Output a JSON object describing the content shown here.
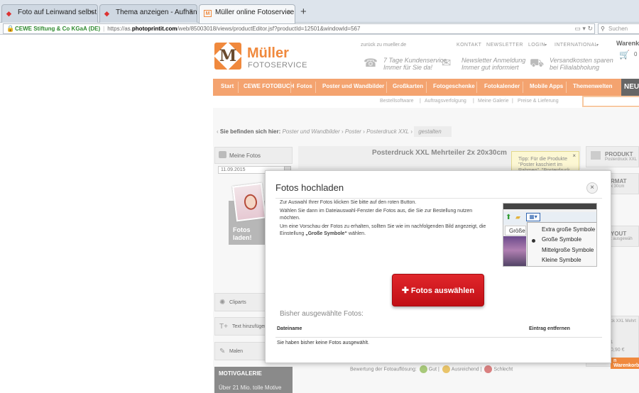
{
  "browser": {
    "tabs": [
      {
        "label": "Foto auf Leinwand selbst g...",
        "close": "×"
      },
      {
        "label": "Thema anzeigen - Aufhän...",
        "close": "×"
      },
      {
        "label": "Müller online Fotoservice",
        "close": "×"
      }
    ],
    "new_tab": "+",
    "url": {
      "org": "CEWE Stiftung & Co KGaA (DE)",
      "scheme": "https://as.",
      "host": "photoprintit.com",
      "path": "/web/85003018/views/productEditor.jsf?productId=12501&windowId=567"
    },
    "search_placeholder": "Suchen"
  },
  "header": {
    "brand": "Müller",
    "brand_sub": "FOTOSERVICE",
    "back_link": "zurück zu mueller.de",
    "top_links": [
      "KONTAKT",
      "NEWSLETTER",
      "LOGIN",
      "INTERNATIONAL"
    ],
    "cart_label": "Warenk",
    "cart_count": "0",
    "features": [
      {
        "l1": "7 Tage Kundenservice",
        "l2": "Immer für Sie da!"
      },
      {
        "l1": "Newsletter Anmeldung",
        "l2": "Immer gut informiert"
      },
      {
        "l1": "Versandkosten sparen",
        "l2": "bei Filialabholung"
      }
    ]
  },
  "nav": {
    "items": [
      "Start",
      "CEWE FOTOBUCH",
      "Fotos",
      "Poster und Wandbilder",
      "Großkarten",
      "Fotogeschenke",
      "Fotokalender",
      "Mobile Apps",
      "Themenwelten"
    ],
    "badge": "NEU",
    "sub_items": [
      "Bestellsoftware",
      "Auftragsverfolgung",
      "Meine Galerie",
      "Preise & Lieferung"
    ]
  },
  "breadcrumb": {
    "label": "Sie befinden sich hier:",
    "items": [
      "Poster und Wandbilder",
      "Poster",
      "Posterdruck XXL"
    ],
    "current": "gestalten"
  },
  "left_panel": {
    "title": "Meine Fotos",
    "date": "11.09.2015",
    "upload_l1": "Fotos",
    "upload_l2": "laden!",
    "items": [
      "Cliparts",
      "Text hinzufügen",
      "Malen"
    ],
    "motiv_title": "MOTIVGALERIE",
    "motiv_sub": "Über 21 Mio. tolle Motive"
  },
  "center": {
    "title": "Posterdruck XXL Mehrteiler 2x 20x30cm",
    "tip_l1": "Tipp: Für die Produkte",
    "tip_l2": "\"Poster kaschiert im",
    "tip_l3": "Rahmen\", \"Posterdruck",
    "rating_label": "Bewertung der Fotoauflösung:",
    "rating_items": [
      "Gut",
      "Ausreichend",
      "Schlecht"
    ]
  },
  "right_panel": {
    "product_h": "PRODUKT",
    "product_s": "Posterdruck XXL",
    "format_h": "RMAT",
    "format_s": "x 30cm",
    "layout_h": "YOUT",
    "layout_s": "t ausgewäh",
    "bottom_s": "ck XXL Mehrt",
    "qty": "1",
    "price": "0,90 €",
    "cart_btn": "n Warenkorb"
  },
  "modal": {
    "title": "Fotos hochladen",
    "close": "×",
    "instr_1": "Zur Auswahl Ihrer Fotos klicken Sie bitte auf den roten Button.",
    "instr_2": "Wählen Sie dann im Dateiauswahl-Fenster die Fotos aus, die Sie zur Bestellung nutzen möchten.",
    "instr_3a": "Um eine Vorschau der Fotos zu erhalten, sollten Sie wie im nachfolgenden Bild angezeigt, die Einstellung ",
    "instr_3b": "„Große Symbole“",
    "instr_3c": " wählen.",
    "example_menu": [
      "Extra große Symbole",
      "Große Symbole",
      "Mittelgroße Symbole",
      "Kleine Symbole"
    ],
    "example_cut": "Größe",
    "button_label": "Fotos auswählen",
    "selected_title": "Bisher ausgewählte Fotos:",
    "col_file": "Dateiname",
    "col_remove": "Eintrag entfernen",
    "empty_msg": "Sie haben bisher keine Fotos ausgewählt."
  },
  "colors": {
    "brand_orange": "#f0893d",
    "nav_orange": "#f4a36f",
    "button_red": "#d11a20"
  }
}
